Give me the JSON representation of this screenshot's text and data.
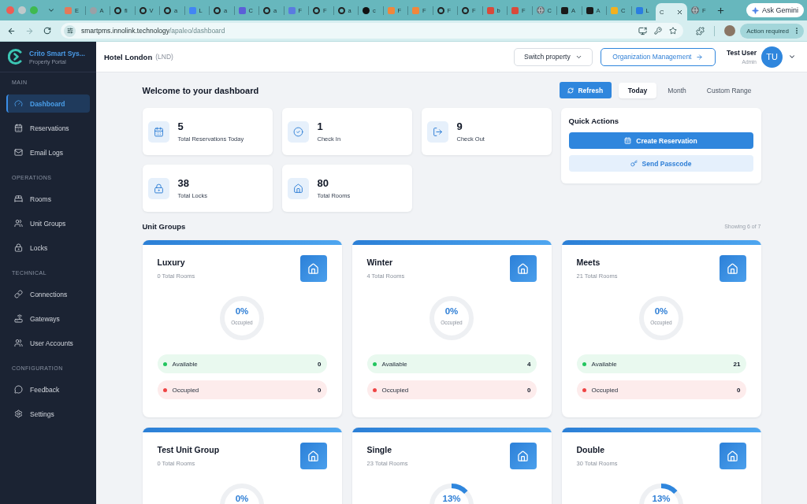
{
  "browser": {
    "tabs": [
      {
        "title": "E",
        "kind": "tile",
        "color": "#e27a5b",
        "selected": false
      },
      {
        "title": "A",
        "kind": "disc",
        "color": "#9aa0a6",
        "selected": false
      },
      {
        "title": "fi",
        "kind": "ring",
        "color": "#222222",
        "selected": false
      },
      {
        "title": "V",
        "kind": "ring",
        "color": "#222222",
        "selected": false
      },
      {
        "title": "a",
        "kind": "ring",
        "color": "#222222",
        "selected": false
      },
      {
        "title": "L",
        "kind": "tile",
        "color": "#4285f4",
        "selected": false
      },
      {
        "title": "a",
        "kind": "ring",
        "color": "#222222",
        "selected": false
      },
      {
        "title": "C",
        "kind": "tile",
        "color": "#5b5fd8",
        "selected": false
      },
      {
        "title": "a",
        "kind": "ring",
        "color": "#222222",
        "selected": false
      },
      {
        "title": "F",
        "kind": "tile",
        "color": "#5a7be0",
        "selected": false
      },
      {
        "title": "F",
        "kind": "ring",
        "color": "#222222",
        "selected": false
      },
      {
        "title": "a",
        "kind": "ring",
        "color": "#222222",
        "selected": false
      },
      {
        "title": "c",
        "kind": "disc",
        "color": "#111111",
        "selected": false
      },
      {
        "title": "F",
        "kind": "tile",
        "color": "#f0873c",
        "selected": false
      },
      {
        "title": "F",
        "kind": "tile",
        "color": "#f0873c",
        "selected": false
      },
      {
        "title": "F",
        "kind": "ring",
        "color": "#222222",
        "selected": false
      },
      {
        "title": "F",
        "kind": "ring",
        "color": "#222222",
        "selected": false
      },
      {
        "title": "b",
        "kind": "tile",
        "color": "#d94a3b",
        "selected": false
      },
      {
        "title": "F",
        "kind": "tile",
        "color": "#d94a3b",
        "selected": false
      },
      {
        "title": "C",
        "kind": "globe",
        "color": "#6b7378",
        "selected": false
      },
      {
        "title": "A",
        "kind": "tile",
        "color": "#1a1a1a",
        "selected": false
      },
      {
        "title": "A",
        "kind": "tile",
        "color": "#1a1a1a",
        "selected": false
      },
      {
        "title": "C",
        "kind": "tile",
        "color": "#f2b01e",
        "selected": false
      },
      {
        "title": "L",
        "kind": "tile",
        "color": "#2a7de1",
        "selected": false
      },
      {
        "title": "C",
        "kind": "blank",
        "selected": true
      },
      {
        "title": "F",
        "kind": "globe",
        "color": "#6b7378",
        "selected": false
      }
    ],
    "ask_gemini": "Ask Gemini",
    "url": {
      "host": "smartpms.innolink.technology",
      "path": "/apaleo/dashboard"
    },
    "action_required": "Action required"
  },
  "sidebar": {
    "brand": "Crito Smart Sys...",
    "subtitle": "Property Portal",
    "sections": [
      {
        "title": "MAIN",
        "items": [
          {
            "label": "Dashboard",
            "selected": true
          },
          {
            "label": "Reservations",
            "selected": false
          },
          {
            "label": "Email Logs",
            "selected": false
          }
        ]
      },
      {
        "title": "OPERATIONS",
        "items": [
          {
            "label": "Rooms",
            "selected": false
          },
          {
            "label": "Unit Groups",
            "selected": false
          },
          {
            "label": "Locks",
            "selected": false
          }
        ]
      },
      {
        "title": "TECHNICAL",
        "items": [
          {
            "label": "Connections",
            "selected": false
          },
          {
            "label": "Gateways",
            "selected": false
          },
          {
            "label": "User Accounts",
            "selected": false
          }
        ]
      },
      {
        "title": "CONFIGURATION",
        "items": [
          {
            "label": "Feedback",
            "selected": false
          },
          {
            "label": "Settings",
            "selected": false
          }
        ]
      }
    ]
  },
  "header": {
    "hotel": "Hotel London",
    "code": "(LND)",
    "switch_property": "Switch property",
    "organization_management": "Organization Management",
    "user": {
      "name": "Test User",
      "role": "Admin",
      "initials": "TU"
    }
  },
  "dashboard": {
    "title": "Welcome to your dashboard",
    "refresh": "Refresh",
    "ranges": [
      {
        "label": "Today",
        "selected": true
      },
      {
        "label": "Month",
        "selected": false
      },
      {
        "label": "Custom Range",
        "selected": false
      }
    ],
    "stats": [
      {
        "value": "5",
        "label": "Total Reservations Today"
      },
      {
        "value": "1",
        "label": "Check In"
      },
      {
        "value": "9",
        "label": "Check Out"
      },
      {
        "value": "38",
        "label": "Total Locks"
      },
      {
        "value": "80",
        "label": "Total Rooms"
      }
    ],
    "quick_actions": {
      "title": "Quick Actions",
      "actions": [
        {
          "label": "Create Reservation",
          "kind": "primary"
        },
        {
          "label": "Send Passcode",
          "kind": "secondary"
        }
      ]
    },
    "unit_groups": {
      "title": "Unit Groups",
      "showing": "Showing 6 of 7",
      "groups": [
        {
          "name": "Luxury",
          "total": "0 Total Rooms",
          "percent": "0%",
          "level": 0,
          "status_label": "Occupied",
          "counts": [
            {
              "label": "Available",
              "value": "0",
              "color": "#22c55e"
            },
            {
              "label": "Occupied",
              "value": "0",
              "color": "#ef4444"
            }
          ]
        },
        {
          "name": "Winter",
          "total": "4 Total Rooms",
          "percent": "0%",
          "level": 0,
          "status_label": "Occupied",
          "counts": [
            {
              "label": "Available",
              "value": "4",
              "color": "#22c55e"
            },
            {
              "label": "Occupied",
              "value": "0",
              "color": "#ef4444"
            }
          ]
        },
        {
          "name": "Meets",
          "total": "21 Total Rooms",
          "percent": "0%",
          "level": 0,
          "status_label": "Occupied",
          "counts": [
            {
              "label": "Available",
              "value": "21",
              "color": "#22c55e"
            },
            {
              "label": "Occupied",
              "value": "0",
              "color": "#ef4444"
            }
          ]
        },
        {
          "name": "Test Unit Group",
          "total": "0 Total Rooms",
          "percent": "0%",
          "level": 0
        },
        {
          "name": "Single",
          "total": "23 Total Rooms",
          "percent": "13%",
          "level": 0.13
        },
        {
          "name": "Double",
          "total": "30 Total Rooms",
          "percent": "13%",
          "level": 0.13
        }
      ]
    }
  }
}
